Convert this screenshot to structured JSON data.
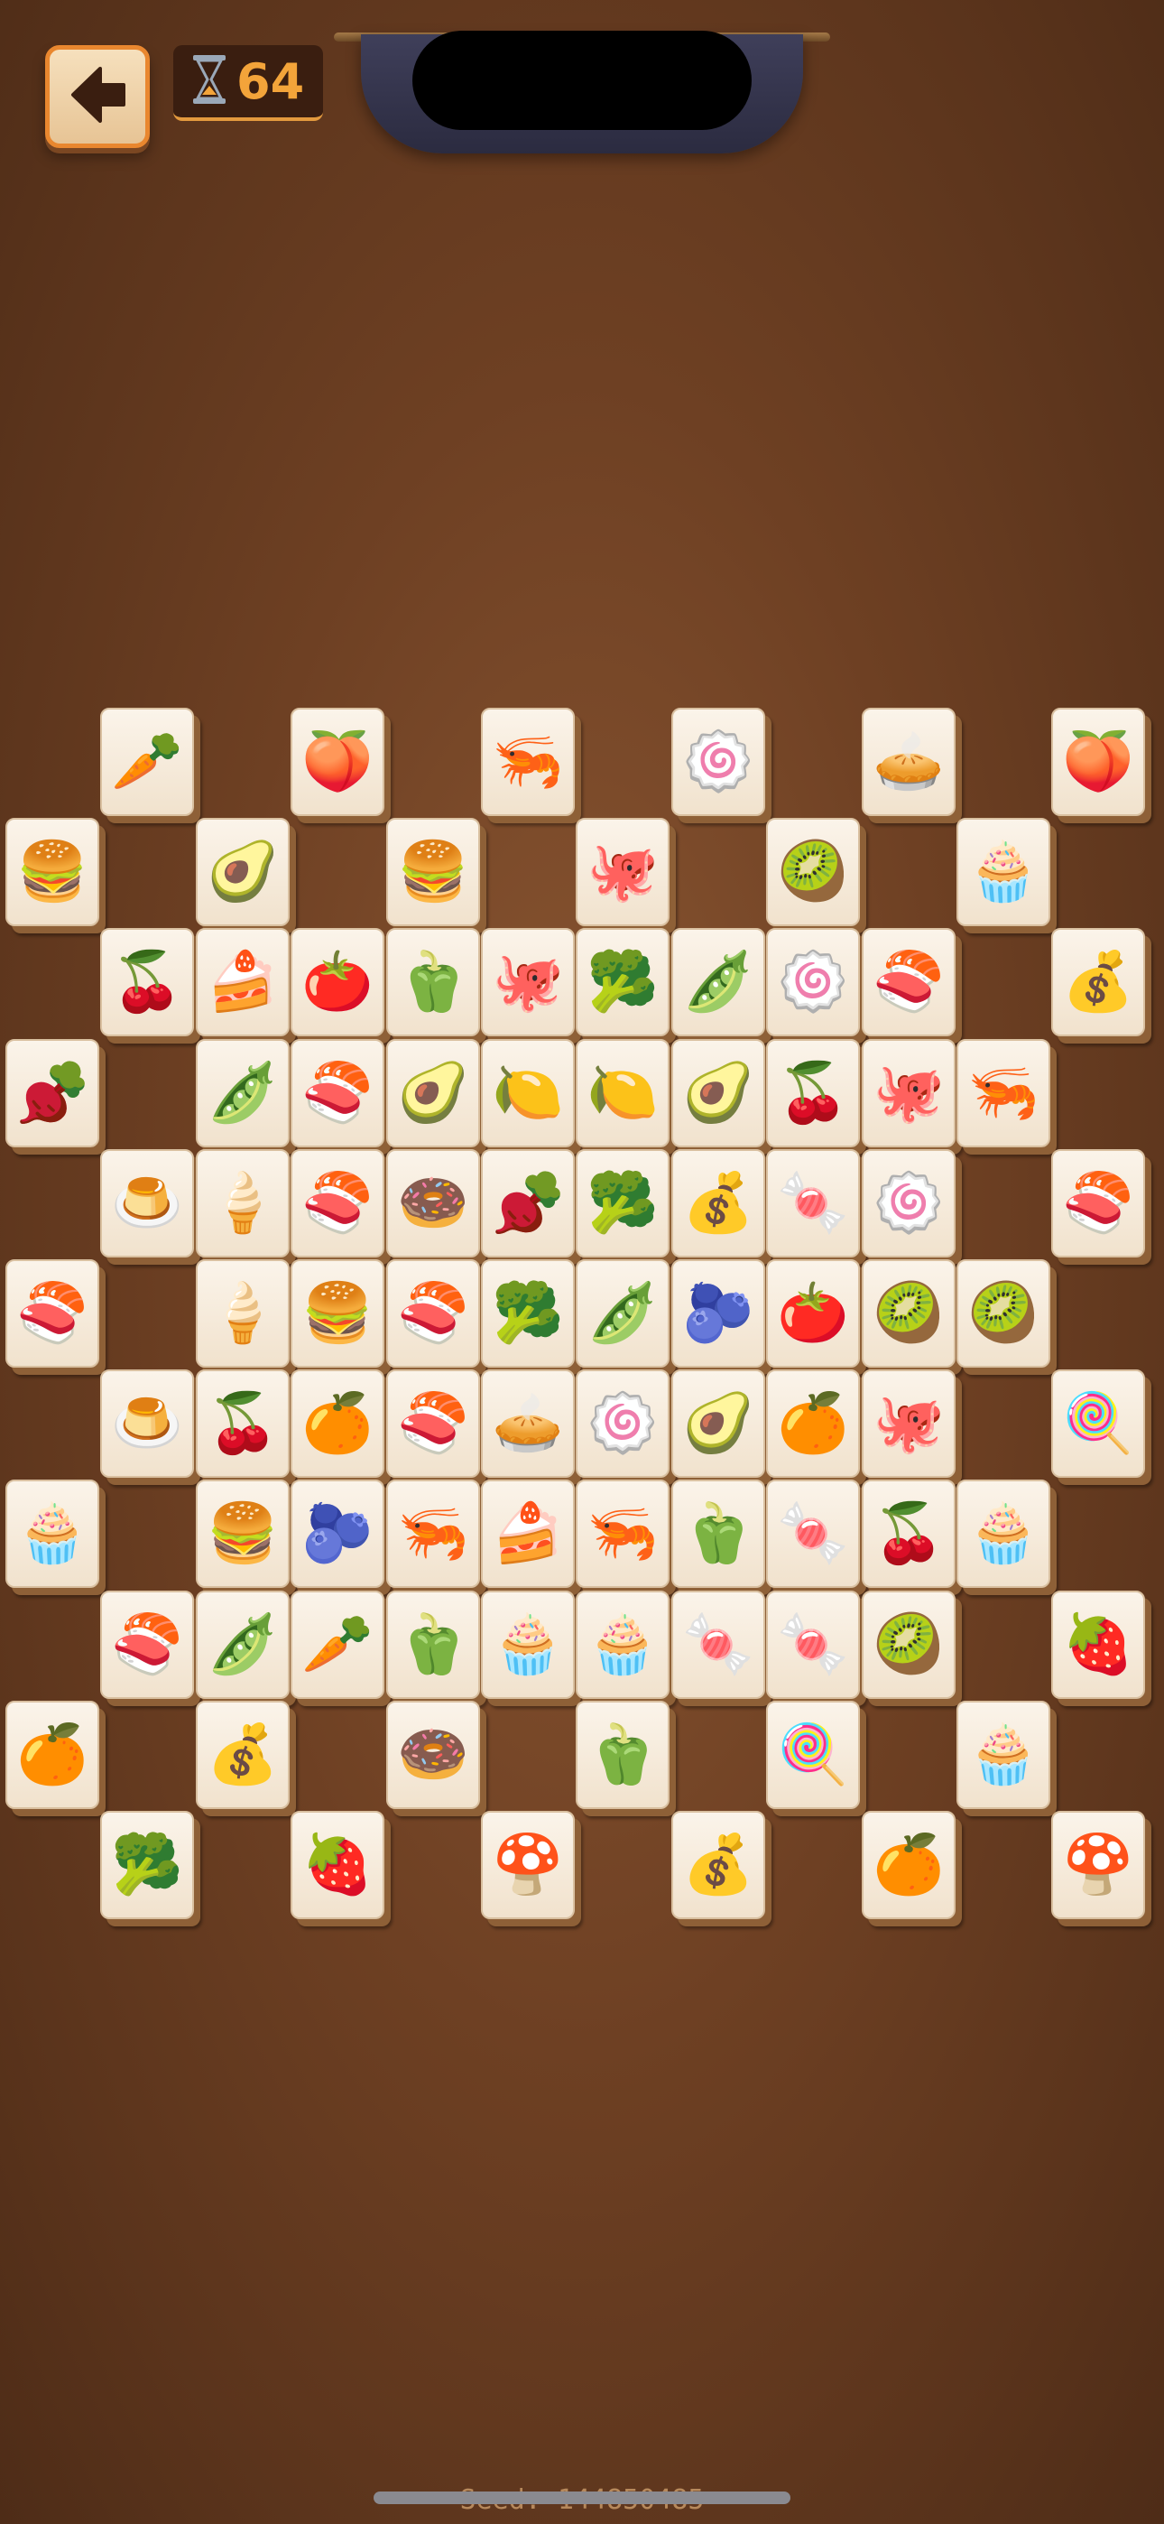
{
  "timer": {
    "value": "64"
  },
  "seed": "Seed:-144850485",
  "colors": {
    "accent": "#e9872f",
    "timer_text": "#f3a43a",
    "tile_face": "#fbf4ea"
  },
  "icons": {
    "back": "arrow-left-icon",
    "timer": "hourglass-icon"
  },
  "tiles": [
    {
      "food": "carrot",
      "glyph": "🥕",
      "col": 2,
      "row": 0,
      "color": "#e8722a"
    },
    {
      "food": "peach",
      "glyph": "🍑",
      "col": 6,
      "row": 0,
      "color": "#f29a7a"
    },
    {
      "food": "shrimp",
      "glyph": "🦐",
      "col": 10,
      "row": 0,
      "color": "#f08a86"
    },
    {
      "food": "swiss-roll",
      "glyph": "🍥",
      "col": 14,
      "row": 0,
      "color": "#b5773d"
    },
    {
      "food": "pie",
      "glyph": "🥧",
      "col": 18,
      "row": 0,
      "color": "#8b4a25"
    },
    {
      "food": "peach",
      "glyph": "🍑",
      "col": 22,
      "row": 0,
      "color": "#f29a7a"
    },
    {
      "food": "macaron",
      "glyph": "🍔",
      "col": 0,
      "row": 1,
      "color": "#e26a8c"
    },
    {
      "food": "avocado",
      "glyph": "🥑",
      "col": 4,
      "row": 1,
      "color": "#6f9b2e"
    },
    {
      "food": "rainbow-macaron",
      "glyph": "🍔",
      "col": 8,
      "row": 1,
      "color": "#e7b43b"
    },
    {
      "food": "octopus",
      "glyph": "🐙",
      "col": 12,
      "row": 1,
      "color": "#e08c87"
    },
    {
      "food": "kiwi",
      "glyph": "🥝",
      "col": 16,
      "row": 1,
      "color": "#7aa92f"
    },
    {
      "food": "cupcake",
      "glyph": "🧁",
      "col": 20,
      "row": 1,
      "color": "#c2334a"
    },
    {
      "food": "cherries",
      "glyph": "🍒",
      "col": 2,
      "row": 2,
      "color": "#c41f2a"
    },
    {
      "food": "cake-slice",
      "glyph": "🍰",
      "col": 4,
      "row": 2,
      "color": "#e9c36a"
    },
    {
      "food": "tomato",
      "glyph": "🍅",
      "col": 6,
      "row": 2,
      "color": "#d8352a"
    },
    {
      "food": "red-pepper",
      "glyph": "🫑",
      "col": 8,
      "row": 2,
      "color": "#c5262a"
    },
    {
      "food": "octopus",
      "glyph": "🐙",
      "col": 10,
      "row": 2,
      "color": "#e08c87"
    },
    {
      "food": "broccoli",
      "glyph": "🥦",
      "col": 12,
      "row": 2,
      "color": "#3f8a2c"
    },
    {
      "food": "peas",
      "glyph": "🫛",
      "col": 14,
      "row": 2,
      "color": "#6ea535"
    },
    {
      "food": "matcha-roll",
      "glyph": "🍥",
      "col": 16,
      "row": 2,
      "color": "#9eaf3c"
    },
    {
      "food": "tuna",
      "glyph": "🍣",
      "col": 18,
      "row": 2,
      "color": "#e2432f"
    },
    {
      "food": "dumpling-bag",
      "glyph": "💰",
      "col": 22,
      "row": 2,
      "color": "#d6b352"
    },
    {
      "food": "beet",
      "glyph": "🫜",
      "col": 0,
      "row": 3,
      "color": "#9b1f45"
    },
    {
      "food": "peas",
      "glyph": "🫛",
      "col": 4,
      "row": 3,
      "color": "#6ea535"
    },
    {
      "food": "salmon",
      "glyph": "🍣",
      "col": 6,
      "row": 3,
      "color": "#ef7a4a"
    },
    {
      "food": "avocado",
      "glyph": "🥑",
      "col": 8,
      "row": 3,
      "color": "#6f9b2e"
    },
    {
      "food": "lemon",
      "glyph": "🍋",
      "col": 10,
      "row": 3,
      "color": "#f1cf1f"
    },
    {
      "food": "lemon",
      "glyph": "🍋",
      "col": 12,
      "row": 3,
      "color": "#f1cf1f"
    },
    {
      "food": "avocado",
      "glyph": "🥑",
      "col": 14,
      "row": 3,
      "color": "#6f9b2e"
    },
    {
      "food": "cherries",
      "glyph": "🍒",
      "col": 16,
      "row": 3,
      "color": "#c41f2a"
    },
    {
      "food": "octopus",
      "glyph": "🐙",
      "col": 18,
      "row": 3,
      "color": "#e08c87"
    },
    {
      "food": "shrimp",
      "glyph": "🦐",
      "col": 20,
      "row": 3,
      "color": "#f08a86"
    },
    {
      "food": "cream-tart",
      "glyph": "🍮",
      "col": 2,
      "row": 4,
      "color": "#d86c9a"
    },
    {
      "food": "green-popsicle",
      "glyph": "🍦",
      "col": 4,
      "row": 4,
      "color": "#5fbf55"
    },
    {
      "food": "salmon",
      "glyph": "🍣",
      "col": 6,
      "row": 4,
      "color": "#ef7a4a"
    },
    {
      "food": "donut",
      "glyph": "🍩",
      "col": 8,
      "row": 4,
      "color": "#8a4d2a"
    },
    {
      "food": "beet",
      "glyph": "🫜",
      "col": 10,
      "row": 4,
      "color": "#9b1f45"
    },
    {
      "food": "broccoli",
      "glyph": "🥦",
      "col": 12,
      "row": 4,
      "color": "#3f8a2c"
    },
    {
      "food": "dumpling-bag",
      "glyph": "💰",
      "col": 14,
      "row": 4,
      "color": "#d6b352"
    },
    {
      "food": "yellow-candy",
      "glyph": "🍬",
      "col": 16,
      "row": 4,
      "color": "#f2cf18"
    },
    {
      "food": "swiss-roll",
      "glyph": "🍥",
      "col": 18,
      "row": 4,
      "color": "#b5773d"
    },
    {
      "food": "tuna",
      "glyph": "🍣",
      "col": 22,
      "row": 4,
      "color": "#e2432f"
    },
    {
      "food": "tuna",
      "glyph": "🍣",
      "col": 0,
      "row": 5,
      "color": "#e2432f"
    },
    {
      "food": "green-popsicle",
      "glyph": "🍦",
      "col": 4,
      "row": 5,
      "color": "#5fbf55"
    },
    {
      "food": "macaron",
      "glyph": "🍔",
      "col": 6,
      "row": 5,
      "color": "#e26a8c"
    },
    {
      "food": "salmon",
      "glyph": "🍣",
      "col": 8,
      "row": 5,
      "color": "#ef7a4a"
    },
    {
      "food": "broccoli",
      "glyph": "🥦",
      "col": 10,
      "row": 5,
      "color": "#3f8a2c"
    },
    {
      "food": "peas",
      "glyph": "🫛",
      "col": 12,
      "row": 5,
      "color": "#6ea535"
    },
    {
      "food": "blueberries",
      "glyph": "🫐",
      "col": 14,
      "row": 5,
      "color": "#4a4fb6"
    },
    {
      "food": "tomato",
      "glyph": "🍅",
      "col": 16,
      "row": 5,
      "color": "#d8352a"
    },
    {
      "food": "kiwi",
      "glyph": "🥝",
      "col": 18,
      "row": 5,
      "color": "#7aa92f"
    },
    {
      "food": "kiwi",
      "glyph": "🥝",
      "col": 20,
      "row": 5,
      "color": "#7aa92f"
    },
    {
      "food": "cream-tart",
      "glyph": "🍮",
      "col": 2,
      "row": 6,
      "color": "#d86c9a"
    },
    {
      "food": "cherries",
      "glyph": "🍒",
      "col": 4,
      "row": 6,
      "color": "#c41f2a"
    },
    {
      "food": "orange",
      "glyph": "🍊",
      "col": 6,
      "row": 6,
      "color": "#f08a1c"
    },
    {
      "food": "tuna",
      "glyph": "🍣",
      "col": 8,
      "row": 6,
      "color": "#e2432f"
    },
    {
      "food": "pie",
      "glyph": "🥧",
      "col": 10,
      "row": 6,
      "color": "#8b4a25"
    },
    {
      "food": "matcha-roll",
      "glyph": "🍥",
      "col": 12,
      "row": 6,
      "color": "#9eaf3c"
    },
    {
      "food": "avocado",
      "glyph": "🥑",
      "col": 14,
      "row": 6,
      "color": "#6f9b2e"
    },
    {
      "food": "orange",
      "glyph": "🍊",
      "col": 16,
      "row": 6,
      "color": "#f08a1c"
    },
    {
      "food": "octopus",
      "glyph": "🐙",
      "col": 18,
      "row": 6,
      "color": "#e08c87"
    },
    {
      "food": "rainbow-popsicle",
      "glyph": "🍭",
      "col": 22,
      "row": 6,
      "color": "#7b57c9"
    },
    {
      "food": "chocolate-cupcake",
      "glyph": "🧁",
      "col": 0,
      "row": 7,
      "color": "#6b3a22"
    },
    {
      "food": "rainbow-macaron",
      "glyph": "🍔",
      "col": 4,
      "row": 7,
      "color": "#e7b43b"
    },
    {
      "food": "blueberries",
      "glyph": "🫐",
      "col": 6,
      "row": 7,
      "color": "#4a4fb6"
    },
    {
      "food": "shrimp",
      "glyph": "🦐",
      "col": 8,
      "row": 7,
      "color": "#f08a86"
    },
    {
      "food": "cake-slice",
      "glyph": "🍰",
      "col": 10,
      "row": 7,
      "color": "#e9c36a"
    },
    {
      "food": "shrimp",
      "glyph": "🦐",
      "col": 12,
      "row": 7,
      "color": "#f08a86"
    },
    {
      "food": "red-pepper",
      "glyph": "🫑",
      "col": 14,
      "row": 7,
      "color": "#c5262a"
    },
    {
      "food": "yellow-candy",
      "glyph": "🍬",
      "col": 16,
      "row": 7,
      "color": "#f2cf18"
    },
    {
      "food": "cherries",
      "glyph": "🍒",
      "col": 18,
      "row": 7,
      "color": "#c41f2a"
    },
    {
      "food": "blue-cupcake",
      "glyph": "🧁",
      "col": 20,
      "row": 7,
      "color": "#3fc1d4"
    },
    {
      "food": "salmon",
      "glyph": "🍣",
      "col": 2,
      "row": 8,
      "color": "#ef7a4a"
    },
    {
      "food": "peas",
      "glyph": "🫛",
      "col": 4,
      "row": 8,
      "color": "#6ea535"
    },
    {
      "food": "carrot",
      "glyph": "🥕",
      "col": 6,
      "row": 8,
      "color": "#e8722a"
    },
    {
      "food": "red-pepper",
      "glyph": "🫑",
      "col": 8,
      "row": 8,
      "color": "#c5262a"
    },
    {
      "food": "chocolate-cupcake",
      "glyph": "🧁",
      "col": 10,
      "row": 8,
      "color": "#6b3a22"
    },
    {
      "food": "blue-cupcake",
      "glyph": "🧁",
      "col": 12,
      "row": 8,
      "color": "#3fc1d4"
    },
    {
      "food": "yellow-candy",
      "glyph": "🍬",
      "col": 14,
      "row": 8,
      "color": "#f2cf18"
    },
    {
      "food": "yellow-candy",
      "glyph": "🍬",
      "col": 16,
      "row": 8,
      "color": "#f2cf18"
    },
    {
      "food": "kiwi",
      "glyph": "🥝",
      "col": 18,
      "row": 8,
      "color": "#7aa92f"
    },
    {
      "food": "strawberry-tart",
      "glyph": "🍓",
      "col": 22,
      "row": 8,
      "color": "#d23b34"
    },
    {
      "food": "orange",
      "glyph": "🍊",
      "col": 0,
      "row": 9,
      "color": "#f08a1c"
    },
    {
      "food": "dumpling-bag",
      "glyph": "💰",
      "col": 4,
      "row": 9,
      "color": "#d6b352"
    },
    {
      "food": "donut",
      "glyph": "🍩",
      "col": 8,
      "row": 9,
      "color": "#8a4d2a"
    },
    {
      "food": "red-pepper",
      "glyph": "🫑",
      "col": 12,
      "row": 9,
      "color": "#c5262a"
    },
    {
      "food": "rainbow-popsicle",
      "glyph": "🍭",
      "col": 16,
      "row": 9,
      "color": "#7b57c9"
    },
    {
      "food": "cupcake",
      "glyph": "🧁",
      "col": 20,
      "row": 9,
      "color": "#c2334a"
    },
    {
      "food": "broccoli",
      "glyph": "🥦",
      "col": 2,
      "row": 10,
      "color": "#3f8a2c"
    },
    {
      "food": "strawberry-tart",
      "glyph": "🍓",
      "col": 6,
      "row": 10,
      "color": "#d23b34"
    },
    {
      "food": "mushroom",
      "glyph": "🍄",
      "col": 10,
      "row": 10,
      "color": "#8a5a3a"
    },
    {
      "food": "dumpling-bag",
      "glyph": "💰",
      "col": 14,
      "row": 10,
      "color": "#d6b352"
    },
    {
      "food": "orange",
      "glyph": "🍊",
      "col": 18,
      "row": 10,
      "color": "#f08a1c"
    },
    {
      "food": "mushroom",
      "glyph": "🍄",
      "col": 22,
      "row": 10,
      "color": "#8a5a3a"
    }
  ]
}
